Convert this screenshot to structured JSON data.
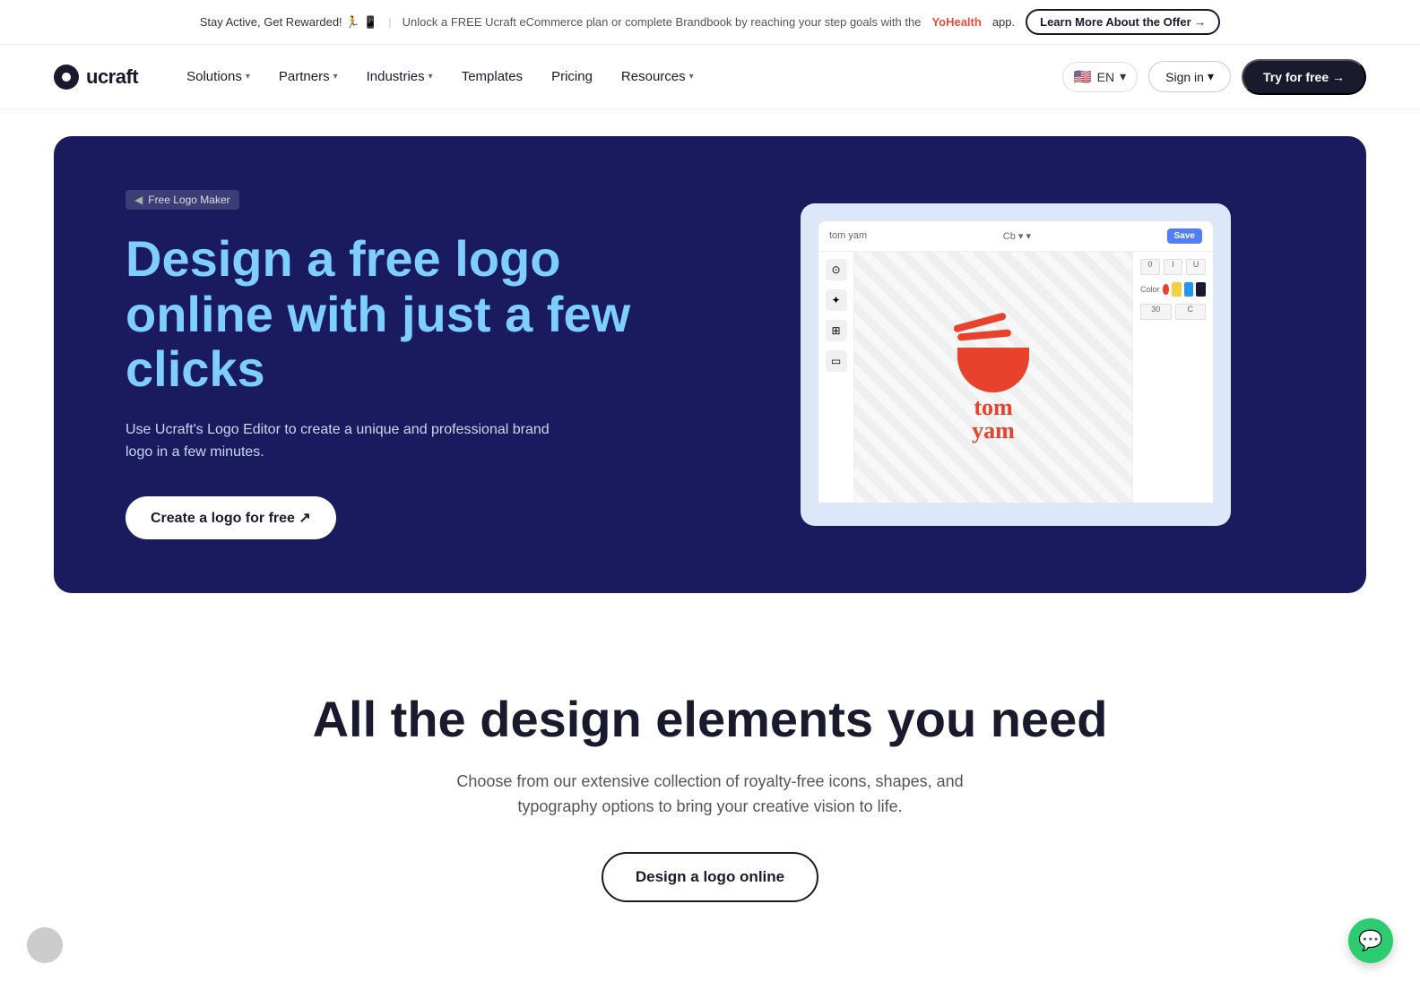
{
  "top_banner": {
    "stay_active": "Stay Active, Get Rewarded! 🏃 📱",
    "unlock_text": "Unlock a FREE Ucraft eCommerce plan or complete Brandbook by reaching your step goals with the",
    "yohealth": "YoHealth",
    "app_text": "app.",
    "learn_more": "Learn More About the Offer →"
  },
  "nav": {
    "logo_text": "ucraft",
    "solutions": "Solutions",
    "partners": "Partners",
    "industries": "Industries",
    "templates": "Templates",
    "pricing": "Pricing",
    "resources": "Resources",
    "lang": "EN",
    "sign_in": "Sign in",
    "try_free": "Try for free →"
  },
  "hero": {
    "breadcrumb": "Free Logo Maker",
    "title": "Design a free logo online with just a few clicks",
    "description": "Use Ucraft's Logo Editor to create a unique and professional brand logo in a few minutes.",
    "cta": "Create a logo for free ↗"
  },
  "editor_mockup": {
    "save_btn": "Save",
    "logo_line1": "tom",
    "logo_line2": "yam"
  },
  "design_section": {
    "title": "All the design elements you need",
    "description": "Choose from our extensive collection of royalty-free icons, shapes, and typography options to bring your creative vision to life.",
    "cta": "Design a logo online"
  },
  "chat": {
    "icon": "💬"
  }
}
